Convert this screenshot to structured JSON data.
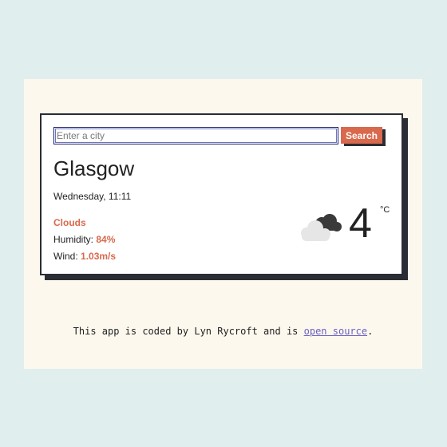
{
  "search": {
    "placeholder": "Enter a city",
    "value": "",
    "button_label": "Search"
  },
  "weather": {
    "city": "Glasgow",
    "date_time": "Wednesday, 11:11",
    "condition": "Clouds",
    "humidity_label": "Humidity:",
    "humidity_value": "84%",
    "wind_label": "Wind:",
    "wind_value": "1.03m/s",
    "temperature": "4",
    "unit": "°C",
    "icon": "clouds-icon"
  },
  "footer": {
    "prefix": "This app is coded by Lyn Rycroft and is ",
    "link_text": "open source",
    "suffix": "."
  },
  "colors": {
    "background": "#e0efed",
    "page": "#fcf8ee",
    "card_border": "#2a2d33",
    "accent": "#d9694d",
    "link": "#6a5fbf"
  }
}
